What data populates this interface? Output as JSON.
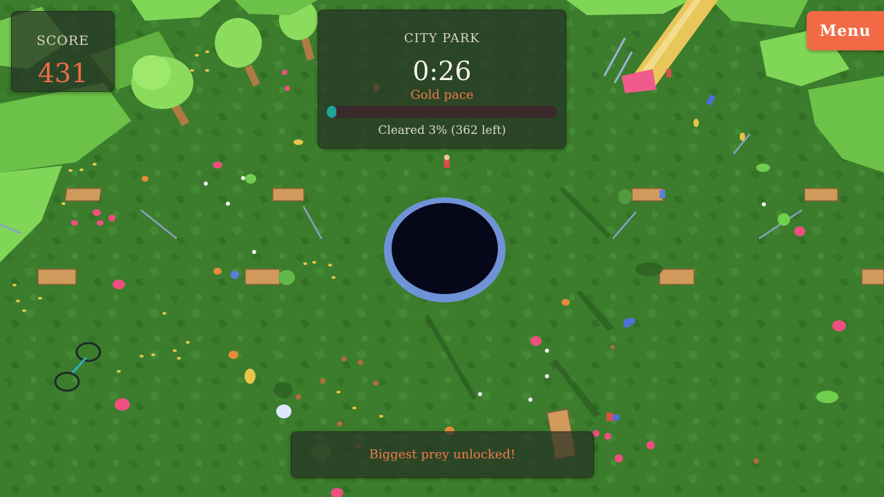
{
  "hud": {
    "score_label": "SCORE",
    "score_value": "431",
    "level_name": "CITY PARK",
    "timer": "0:26",
    "pace": "Gold pace",
    "progress_fraction": 0.03,
    "cleared_text": "Cleared 3%   (362 left)",
    "menu_label": "Menu"
  },
  "toast": {
    "message": "Biggest prey unlocked!"
  },
  "colors": {
    "grass": "#3b7d2c",
    "accent": "#f26a45",
    "progress": "#1fa39a",
    "hole_rim": "#6f93d6",
    "hole": "#07071a"
  }
}
